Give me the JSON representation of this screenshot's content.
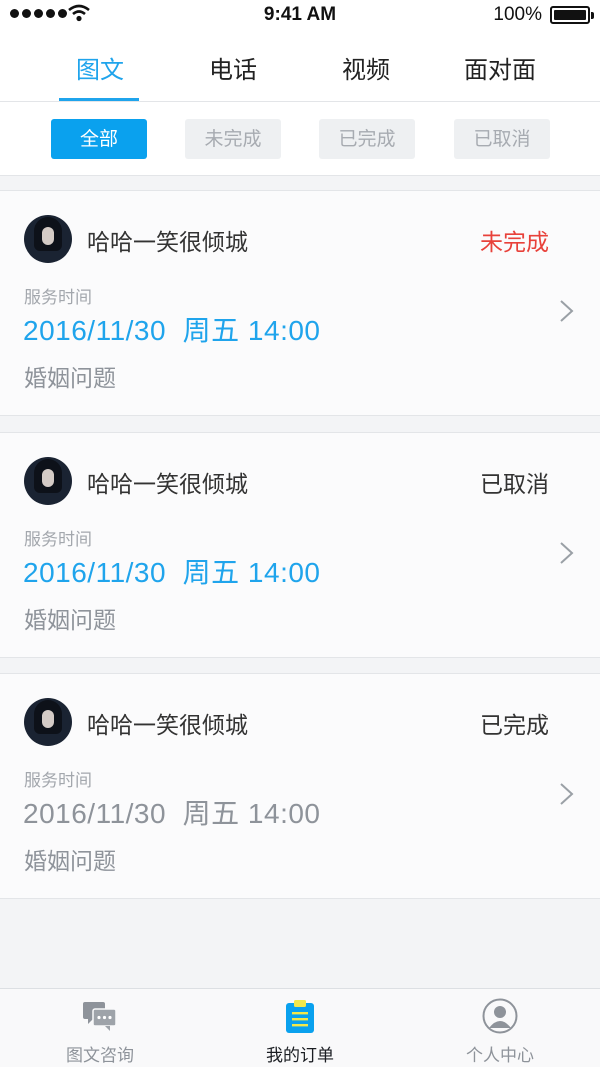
{
  "status_bar": {
    "time": "9:41 AM",
    "battery": "100%"
  },
  "top_tabs": [
    {
      "label": "图文"
    },
    {
      "label": "电话"
    },
    {
      "label": "视频"
    },
    {
      "label": "面对面"
    }
  ],
  "top_tabs_active": "图文",
  "filters": [
    {
      "label": "全部"
    },
    {
      "label": "未完成"
    },
    {
      "label": "已完成"
    },
    {
      "label": "已取消"
    }
  ],
  "filters_active": "全部",
  "orders": [
    {
      "name": "哈哈一笑很倾城",
      "status": "未完成",
      "status_color": "#e8413a",
      "time_label": "服务时间",
      "date": "2016/11/30",
      "weekday": "周五",
      "clock": "14:00",
      "topic": "婚姻问题"
    },
    {
      "name": "哈哈一笑很倾城",
      "status": "已取消",
      "status_color": "#333333",
      "time_label": "服务时间",
      "date": "2016/11/30",
      "weekday": "周五",
      "clock": "14:00",
      "topic": "婚姻问题"
    },
    {
      "name": "哈哈一笑很倾城",
      "status": "已完成",
      "status_color": "#333333",
      "time_label": "服务时间",
      "date": "2016/11/30",
      "weekday": "周五",
      "clock": "14:00",
      "topic": "婚姻问题"
    }
  ],
  "bottom_nav": [
    {
      "label": "图文咨询",
      "icon": "chat-bubbles-icon"
    },
    {
      "label": "我的订单",
      "icon": "clipboard-list-icon"
    },
    {
      "label": "个人中心",
      "icon": "user-profile-icon"
    }
  ],
  "bottom_nav_active": "我的订单",
  "colors": {
    "accent": "#1fa4ec",
    "pending": "#e8413a",
    "muted": "#8e939a"
  }
}
